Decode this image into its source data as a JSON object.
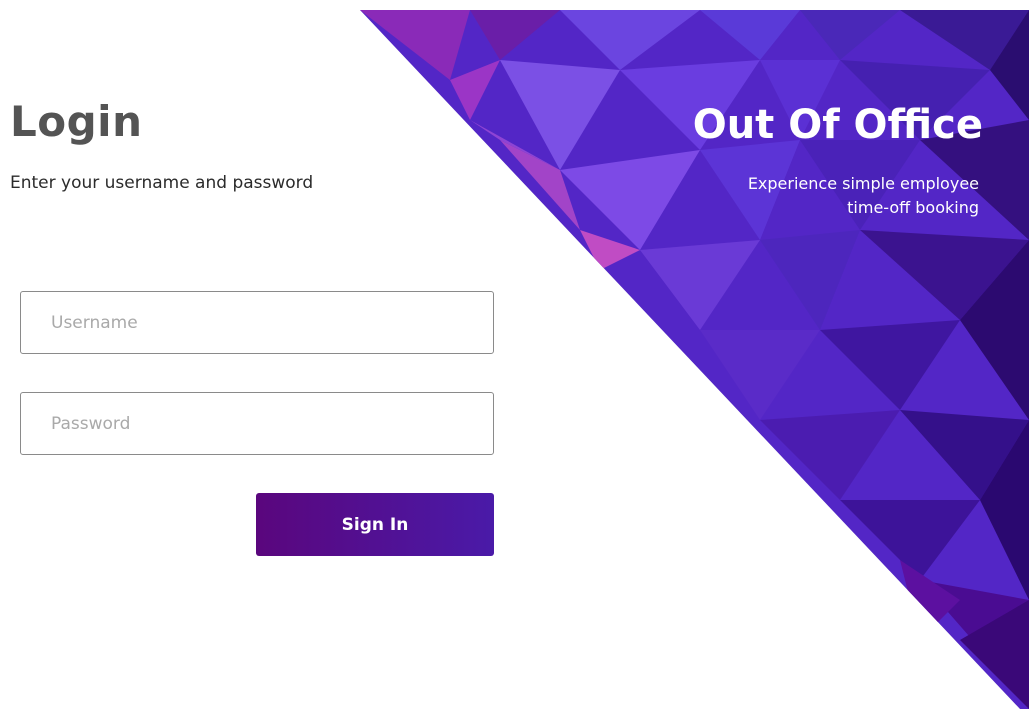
{
  "login": {
    "title": "Login",
    "subtitle": "Enter your username and password",
    "username_placeholder": "Username",
    "password_placeholder": "Password",
    "username_value": "",
    "password_value": "",
    "sign_in_label": "Sign In"
  },
  "brand": {
    "title": "Out Of Office",
    "tagline_line1": "Experience simple employee",
    "tagline_line2": "time-off booking"
  },
  "colors": {
    "title_gray": "#545454",
    "button_start": "#5a067d",
    "button_end": "#4a1aa8",
    "panel_purple": "#5b2bd0",
    "panel_deep": "#3a0a7a"
  }
}
